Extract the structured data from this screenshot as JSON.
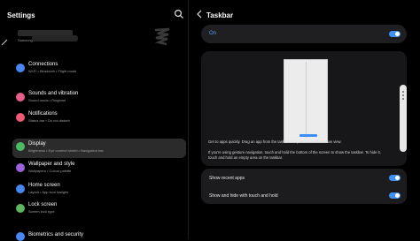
{
  "left_panel": {
    "title": "Settings",
    "account_label": "Samsung account",
    "items": [
      {
        "title": "Connections",
        "subtitle": "Wi-Fi • Bluetooth • Flight mode",
        "icon": "wifi-icon",
        "color": "#4a86f0"
      },
      {
        "title": "Sounds and vibration",
        "subtitle": "Sound mode • Ringtone",
        "icon": "sound-icon",
        "color": "#e85e8a"
      },
      {
        "title": "Notifications",
        "subtitle": "Status bar • Do not disturb",
        "icon": "bell-icon",
        "color": "#ec5a76"
      },
      {
        "title": "Display",
        "subtitle": "Brightness • Eye comfort shield • Navigation bar",
        "icon": "display-icon",
        "color": "#4cbc63"
      },
      {
        "title": "Wallpaper and style",
        "subtitle": "Wallpapers • Colour palette",
        "icon": "palette-icon",
        "color": "#9a63d9"
      },
      {
        "title": "Home screen",
        "subtitle": "Layout • App icon badges",
        "icon": "home-icon",
        "color": "#4a86f0"
      },
      {
        "title": "Lock screen",
        "subtitle": "Screen lock type",
        "icon": "lock-icon",
        "color": "#5db55f"
      },
      {
        "title": "Biometrics and security",
        "subtitle": "",
        "icon": "shield-icon",
        "color": "#4a86f0"
      }
    ]
  },
  "right_panel": {
    "title": "Taskbar",
    "main_toggle": {
      "label": "On",
      "on": true
    },
    "desc1": "Get to apps quickly. Drag an app from the taskbar to open it in multi window view.",
    "desc2a": "If you're using gesture navigation, touch and hold the bottom of the screen to show the taskbar. To hide it,",
    "desc2b": "touch and hold an empty area on the taskbar.",
    "options": [
      {
        "label": "Show recent apps",
        "on": true
      },
      {
        "label": "Show and hide with touch and hold",
        "on": true
      }
    ]
  },
  "colors": {
    "accent": "#3e91f5",
    "background": "#000000",
    "card": "#1c1c1e"
  }
}
